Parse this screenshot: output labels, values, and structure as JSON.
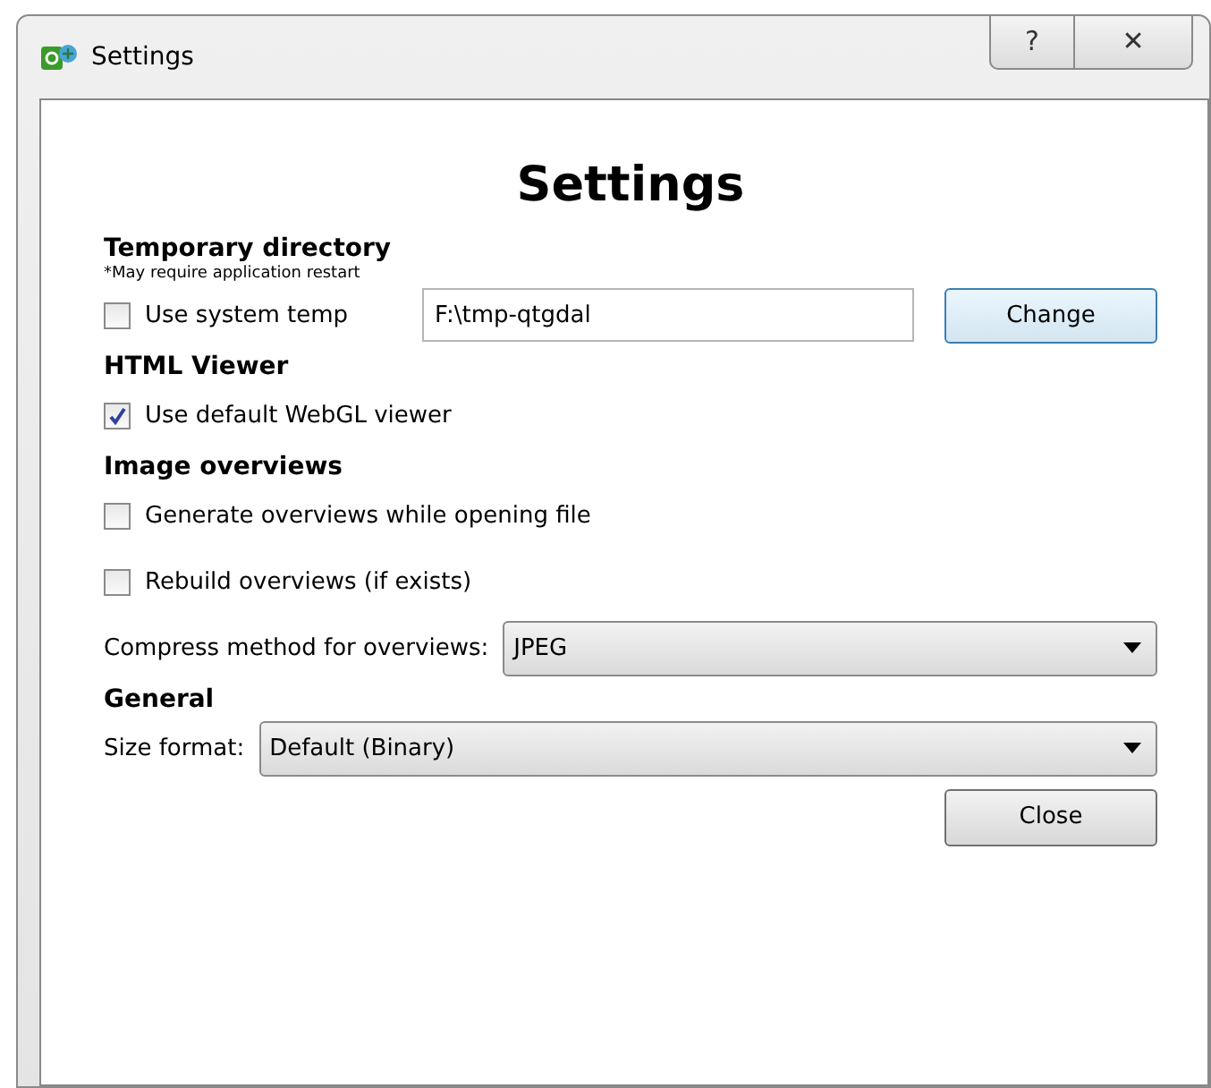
{
  "window": {
    "title": "Settings",
    "buttons": [
      {
        "kind": "help",
        "label": "?"
      },
      {
        "kind": "close",
        "label": "✕"
      }
    ]
  },
  "heading": "Settings",
  "sections": [
    {
      "title": "Temporary directory",
      "note": "*May require application restart",
      "items": [
        {
          "kind": "checkbox_path",
          "label": "Use system temp",
          "checked": false,
          "value": "F:\\tmp-qtgdal",
          "button": "Change"
        }
      ]
    },
    {
      "title": "HTML Viewer",
      "items": [
        {
          "kind": "checkbox",
          "label": "Use default WebGL viewer",
          "checked": true
        }
      ]
    },
    {
      "title": "Image overviews",
      "items": [
        {
          "kind": "checkbox",
          "label": "Generate overviews while opening file",
          "checked": false
        },
        {
          "kind": "checkbox",
          "label": "Rebuild overviews (if exists)",
          "checked": false
        },
        {
          "kind": "combo",
          "label": "Compress method for overviews:",
          "value": "JPEG"
        }
      ]
    },
    {
      "title": "General",
      "items": [
        {
          "kind": "combo",
          "label": "Size format:",
          "value": "Default (Binary)"
        }
      ]
    }
  ],
  "footer_button": "Close"
}
